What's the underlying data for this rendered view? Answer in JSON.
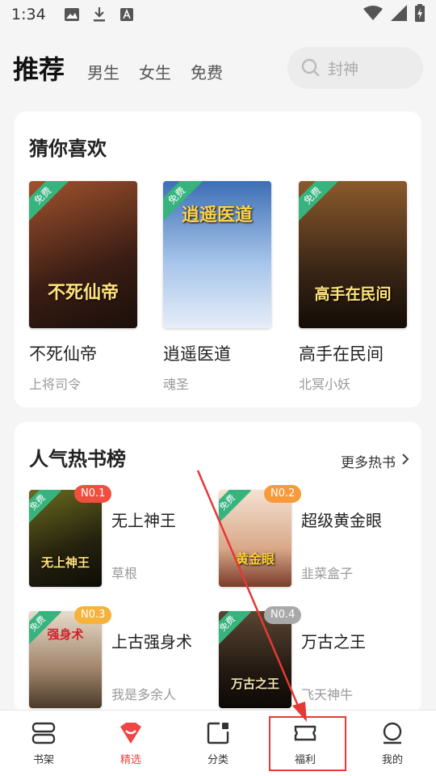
{
  "status_bar": {
    "time": "1:34",
    "icons": [
      "image-icon",
      "download-icon",
      "a-icon"
    ],
    "right_icons": [
      "wifi-icon",
      "signal-icon",
      "battery-icon"
    ]
  },
  "header": {
    "tabs": [
      "推荐",
      "男生",
      "女生",
      "免费"
    ],
    "search_placeholder": "封神"
  },
  "guess": {
    "title": "猜你喜欢",
    "free_label": "免费",
    "books": [
      {
        "title": "不死仙帝",
        "author": "上将司令",
        "cover_text": "不死仙帝",
        "cover_color": "#6b3b2a"
      },
      {
        "title": "逍遥医道",
        "author": "魂圣",
        "cover_text": "逍遥医道",
        "cover_color": "#8aa8d8"
      },
      {
        "title": "高手在民间",
        "author": "北冥小妖",
        "cover_text": "高手在民间",
        "cover_color": "#5a3a1c"
      }
    ]
  },
  "hot": {
    "title": "人气热书榜",
    "more": "更多热书",
    "free_label": "免费",
    "items": [
      {
        "rank": "N0.1",
        "title": "无上神王",
        "author": "草根",
        "badge_color": "#f04e3e",
        "cover_color": "#3a3a1a",
        "cover_text": "无上神王"
      },
      {
        "rank": "N0.2",
        "title": "超级黄金眼",
        "author": "韭菜盒子",
        "badge_color": "#f79a3b",
        "cover_color": "#e8c9b0",
        "cover_text": "黄金眼"
      },
      {
        "rank": "N0.3",
        "title": "上古强身术",
        "author": "我是多余人",
        "badge_color": "#f7b23b",
        "cover_color": "#c9b7a0",
        "cover_text": "强身术"
      },
      {
        "rank": "N0.4",
        "title": "万古之王",
        "author": "飞天神牛",
        "badge_color": "#a9a9a9",
        "cover_color": "#2a2018",
        "cover_text": "万古之王"
      }
    ]
  },
  "bottom_nav": [
    {
      "label": "书架",
      "icon": "bookshelf-icon"
    },
    {
      "label": "精选",
      "icon": "featured-icon"
    },
    {
      "label": "分类",
      "icon": "category-icon"
    },
    {
      "label": "福利",
      "icon": "ticket-icon"
    },
    {
      "label": "我的",
      "icon": "profile-icon"
    }
  ],
  "colors": {
    "accent": "#f04545",
    "free_green": "#37b37e",
    "annotation_red": "#e53935"
  }
}
